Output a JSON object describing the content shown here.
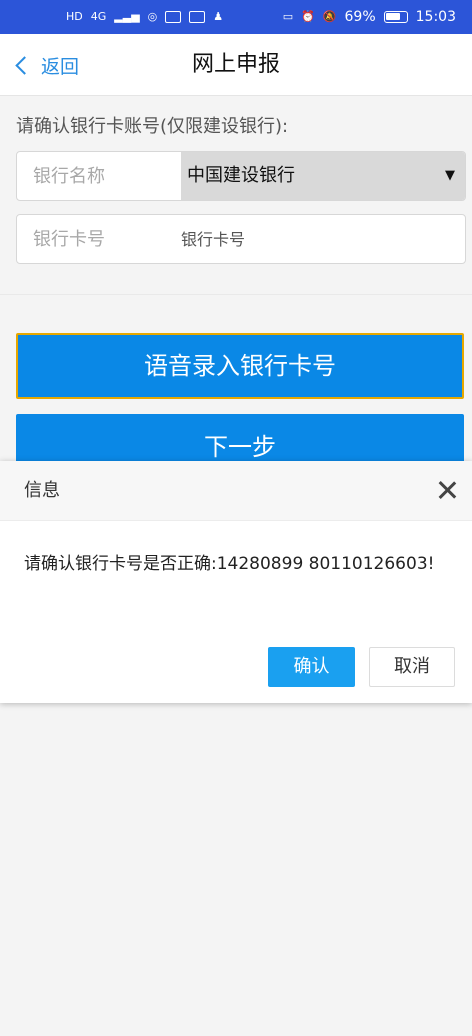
{
  "status_bar": {
    "left_icons": [
      "HD",
      "4G",
      "signal-icon",
      "hotspot-icon",
      "screen-icon",
      "app-icon",
      "qq-icon"
    ],
    "battery": "69%",
    "time": "15:03"
  },
  "topbar": {
    "back_label": "返回",
    "title": "网上申报"
  },
  "form": {
    "prompt": "请确认银行卡账号(仅限建设银行):",
    "bank_label": "银行名称",
    "bank_value": "中国建设银行",
    "card_label": "银行卡号",
    "card_placeholder": "银行卡号"
  },
  "buttons": {
    "voice": "语音录入银行卡号",
    "next": "下一步"
  },
  "dialog": {
    "title": "信息",
    "message": "请确认银行卡号是否正确:14280899 80110126603!",
    "ok": "确认",
    "cancel": "取消"
  },
  "colors": {
    "status_bar": "#2c55d8",
    "primary": "#0a88e6",
    "ok_button": "#1aa0f0"
  }
}
